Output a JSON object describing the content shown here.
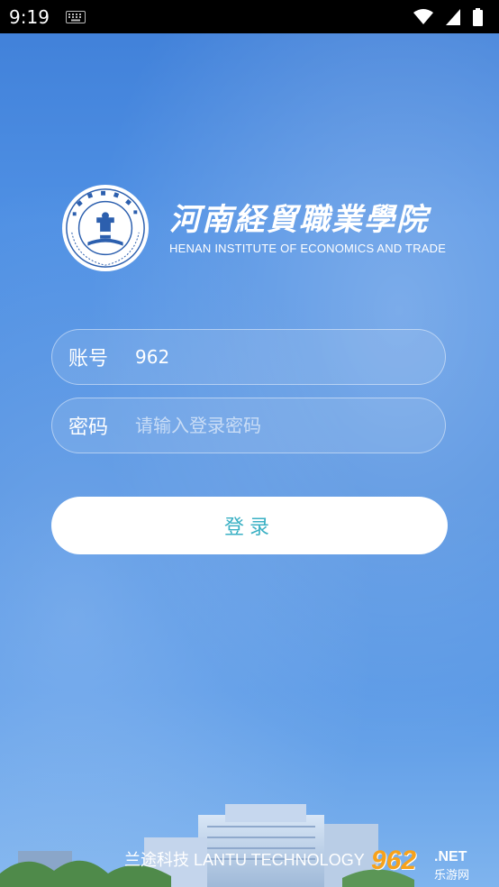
{
  "status_bar": {
    "time": "9:19"
  },
  "brand": {
    "name_cn": "河南経貿職業學院",
    "name_en": "HENAN INSTITUTE OF ECONOMICS AND TRADE"
  },
  "login_form": {
    "account": {
      "label": "账号",
      "value": "962"
    },
    "password": {
      "label": "密码",
      "placeholder": "请输入登录密码"
    },
    "submit_label": "登录"
  },
  "footer": {
    "credit": "兰途科技 LANTU TECHNOLOGY"
  },
  "watermark": {
    "number": "962",
    "suffix": ".NET",
    "site": "乐游网"
  },
  "colors": {
    "accent": "#3ab0c4",
    "background": "#4f8fe0",
    "status_bar": "#000000"
  }
}
